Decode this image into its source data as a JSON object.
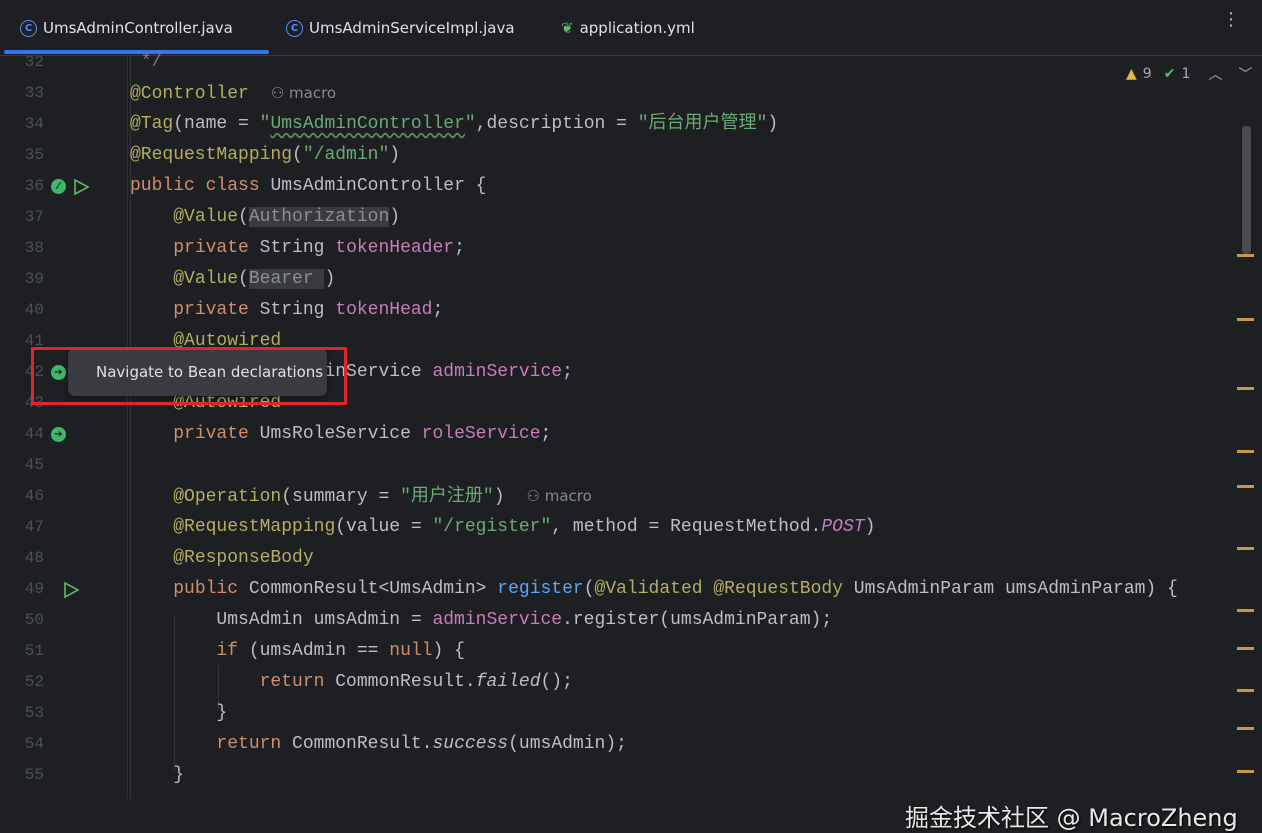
{
  "tabs": [
    {
      "label": "UmsAdminController.java",
      "icon": "class-icon",
      "active": true
    },
    {
      "label": "UmsAdminServiceImpl.java",
      "icon": "class-icon",
      "active": false
    },
    {
      "label": "application.yml",
      "icon": "spring-leaf-icon",
      "active": false
    }
  ],
  "tab_close": "×",
  "more_menu": "⋮",
  "inspections": {
    "warnings": "9",
    "typos": "1"
  },
  "author_hint": "macro",
  "tooltip": "Navigate to Bean declarations",
  "watermark": "掘金技术社区 @ MacroZheng",
  "colors": {
    "accent": "#3574f0",
    "highlight_box": "#e0262b",
    "keyword": "#cf8e6d",
    "annotation": "#b3ae60",
    "string": "#6aab73",
    "field": "#c77dbb",
    "method": "#56a8f5"
  },
  "lines": [
    {
      "n": "32",
      "t": [
        [
          " */",
          "c"
        ]
      ]
    },
    {
      "n": "33",
      "t": [
        [
          "@Controller",
          "a"
        ]
      ],
      "hint": true
    },
    {
      "n": "34",
      "t": [
        [
          "@Tag",
          "a"
        ],
        [
          "(name = ",
          "p"
        ],
        [
          "\"",
          "s"
        ],
        [
          "UmsAdminController",
          "s sq"
        ],
        [
          "\"",
          "s"
        ],
        [
          ",description = ",
          "p"
        ],
        [
          "\"后台用户管理\"",
          "s"
        ],
        [
          ")",
          "p"
        ]
      ]
    },
    {
      "n": "35",
      "t": [
        [
          "@RequestMapping",
          "a"
        ],
        [
          "(",
          "p"
        ],
        [
          "\"/admin\"",
          "s"
        ],
        [
          ")",
          "p"
        ]
      ]
    },
    {
      "n": "36",
      "t": [
        [
          "public class ",
          "k"
        ],
        [
          "UmsAdminController {",
          "p"
        ]
      ],
      "icons": [
        "bean",
        "run"
      ]
    },
    {
      "n": "37",
      "t": [
        [
          "    ",
          "p"
        ],
        [
          "@Value",
          "a"
        ],
        [
          "(",
          "p"
        ],
        [
          "Authorization",
          "h"
        ],
        [
          ")",
          "p"
        ]
      ]
    },
    {
      "n": "38",
      "t": [
        [
          "    ",
          "p"
        ],
        [
          "private ",
          "k"
        ],
        [
          "String ",
          "p"
        ],
        [
          "tokenHeader",
          "f"
        ],
        [
          ";",
          "p"
        ]
      ]
    },
    {
      "n": "39",
      "t": [
        [
          "    ",
          "p"
        ],
        [
          "@Value",
          "a"
        ],
        [
          "(",
          "p"
        ],
        [
          "Bearer ",
          "h"
        ],
        [
          ")",
          "p"
        ]
      ]
    },
    {
      "n": "40",
      "t": [
        [
          "    ",
          "p"
        ],
        [
          "private ",
          "k"
        ],
        [
          "String ",
          "p"
        ],
        [
          "tokenHead",
          "f"
        ],
        [
          ";",
          "p"
        ]
      ]
    },
    {
      "n": "41",
      "t": [
        [
          "    ",
          "p"
        ],
        [
          "@Autowired",
          "a"
        ]
      ]
    },
    {
      "n": "42",
      "t": [
        [
          "    ",
          "p"
        ],
        [
          "private ",
          "k"
        ],
        [
          "UmsAdminService ",
          "p"
        ],
        [
          "adminService",
          "f"
        ],
        [
          ";",
          "p"
        ]
      ],
      "icons": [
        "nav"
      ]
    },
    {
      "n": "43",
      "t": [
        [
          "    ",
          "p"
        ],
        [
          "@Autowired",
          "a"
        ]
      ]
    },
    {
      "n": "44",
      "t": [
        [
          "    ",
          "p"
        ],
        [
          "private ",
          "k"
        ],
        [
          "UmsRoleService ",
          "p"
        ],
        [
          "roleService",
          "f"
        ],
        [
          ";",
          "p"
        ]
      ],
      "icons": [
        "nav"
      ]
    },
    {
      "n": "45",
      "t": []
    },
    {
      "n": "46",
      "t": [
        [
          "    ",
          "p"
        ],
        [
          "@Operation",
          "a"
        ],
        [
          "(summary = ",
          "p"
        ],
        [
          "\"用户注册\"",
          "s"
        ],
        [
          ")",
          "p"
        ]
      ],
      "hint": true
    },
    {
      "n": "47",
      "t": [
        [
          "    ",
          "p"
        ],
        [
          "@RequestMapping",
          "a"
        ],
        [
          "(value = ",
          "p"
        ],
        [
          "\"/register\"",
          "s"
        ],
        [
          ", method = RequestMethod.",
          "p"
        ],
        [
          "POST",
          "ip"
        ],
        [
          ")",
          "p"
        ]
      ]
    },
    {
      "n": "48",
      "t": [
        [
          "    ",
          "p"
        ],
        [
          "@ResponseBody",
          "a"
        ]
      ]
    },
    {
      "n": "49",
      "t": [
        [
          "    ",
          "p"
        ],
        [
          "public ",
          "k"
        ],
        [
          "CommonResult<UmsAdmin> ",
          "p"
        ],
        [
          "register",
          "m"
        ],
        [
          "(",
          "p"
        ],
        [
          "@Validated @RequestBody ",
          "a"
        ],
        [
          "UmsAdminParam umsAdminParam) {",
          "p"
        ]
      ],
      "icons": [
        "run"
      ]
    },
    {
      "n": "50",
      "t": [
        [
          "        UmsAdmin umsAdmin = ",
          "p"
        ],
        [
          "adminService",
          "f"
        ],
        [
          ".register(umsAdminParam);",
          "p"
        ]
      ]
    },
    {
      "n": "51",
      "t": [
        [
          "        ",
          "p"
        ],
        [
          "if ",
          "k"
        ],
        [
          "(umsAdmin == ",
          "p"
        ],
        [
          "null",
          "k"
        ],
        [
          ") {",
          "p"
        ]
      ]
    },
    {
      "n": "52",
      "t": [
        [
          "            ",
          "p"
        ],
        [
          "return ",
          "k"
        ],
        [
          "CommonResult.",
          "p"
        ],
        [
          "failed",
          "i"
        ],
        [
          "();",
          "p"
        ]
      ]
    },
    {
      "n": "53",
      "t": [
        [
          "        }",
          "p"
        ]
      ]
    },
    {
      "n": "54",
      "t": [
        [
          "        ",
          "p"
        ],
        [
          "return ",
          "k"
        ],
        [
          "CommonResult.",
          "p"
        ],
        [
          "success",
          "i"
        ],
        [
          "(umsAdmin);",
          "p"
        ]
      ]
    },
    {
      "n": "55",
      "t": [
        [
          "    }",
          "p"
        ]
      ]
    }
  ]
}
